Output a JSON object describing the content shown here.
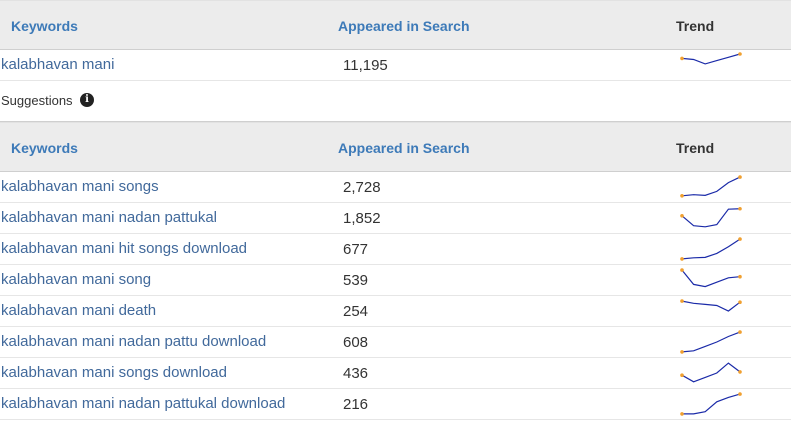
{
  "colors": {
    "link": "#41699b",
    "header_link": "#3d7ab8",
    "spark_line": "#1a2aa8",
    "spark_dot": "#f0a030"
  },
  "main_header": {
    "keywords": "Keywords",
    "appeared": "Appeared in Search",
    "trend": "Trend"
  },
  "main_row": {
    "keyword": "kalabhavan mani",
    "count": "11,195",
    "trend": [
      0.8,
      0.75,
      0.55,
      0.7,
      0.85,
      1.0
    ]
  },
  "suggestions": {
    "label": "Suggestions",
    "info_icon": "info-icon"
  },
  "suggest_header": {
    "keywords": "Keywords",
    "appeared": "Appeared in Search",
    "trend": "Trend"
  },
  "rows": [
    {
      "keyword": "kalabhavan mani songs",
      "count": "2,728",
      "trend": [
        0.1,
        0.15,
        0.12,
        0.3,
        0.7,
        0.95
      ]
    },
    {
      "keyword": "kalabhavan mani nadan pattukal",
      "count": "1,852",
      "trend": [
        0.6,
        0.15,
        0.1,
        0.2,
        0.9,
        0.92
      ]
    },
    {
      "keyword": "kalabhavan mani hit songs download",
      "count": "677",
      "trend": [
        0.05,
        0.1,
        0.12,
        0.3,
        0.6,
        0.95
      ]
    },
    {
      "keyword": "kalabhavan mani song",
      "count": "539",
      "trend": [
        0.95,
        0.3,
        0.2,
        0.4,
        0.6,
        0.65
      ]
    },
    {
      "keyword": "kalabhavan mani death",
      "count": "254",
      "trend": [
        0.95,
        0.85,
        0.8,
        0.75,
        0.5,
        0.9
      ]
    },
    {
      "keyword": "kalabhavan mani nadan pattu download",
      "count": "608",
      "trend": [
        0.05,
        0.1,
        0.3,
        0.5,
        0.75,
        0.95
      ]
    },
    {
      "keyword": "kalabhavan mani songs download",
      "count": "436",
      "trend": [
        0.4,
        0.1,
        0.3,
        0.5,
        0.95,
        0.55
      ]
    },
    {
      "keyword": "kalabhavan mani nadan pattukal download",
      "count": "216",
      "trend": [
        0.05,
        0.05,
        0.15,
        0.6,
        0.8,
        0.95
      ]
    }
  ]
}
